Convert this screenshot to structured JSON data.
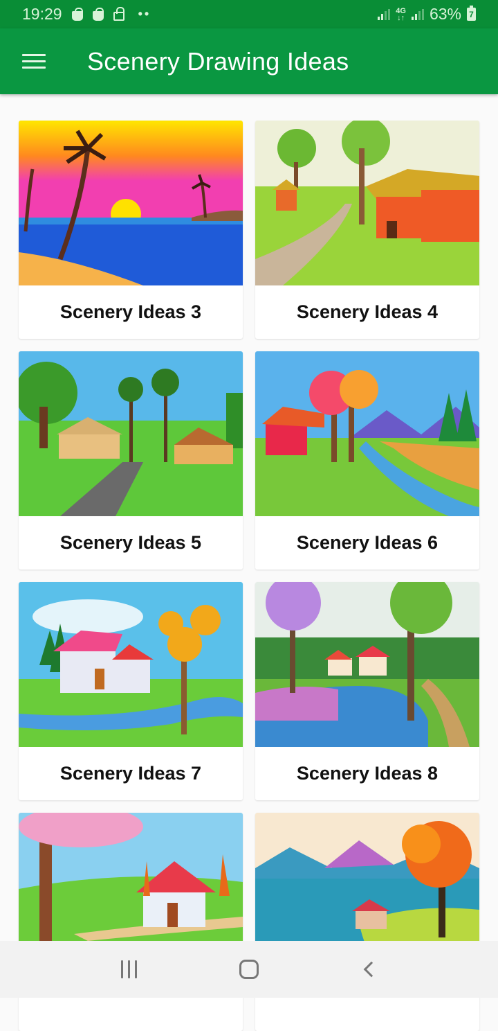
{
  "status_bar": {
    "time": "19:29",
    "network": "4G",
    "battery_percent": "63%",
    "battery_glyph": "7",
    "icons": [
      "shopping-bag-icon",
      "shopping-bag-icon",
      "lock-icon",
      "more-dots-icon",
      "signal-icon",
      "4g-icon",
      "signal-icon",
      "battery-charging-icon"
    ]
  },
  "app_bar": {
    "title": "Scenery Drawing Ideas",
    "menu_icon": "hamburger-menu-icon",
    "color": "#0a9741"
  },
  "cards": [
    {
      "label": "Scenery Ideas 3",
      "scene": "sunset-beach-palms"
    },
    {
      "label": "Scenery Ideas 4",
      "scene": "village-houses-path"
    },
    {
      "label": "Scenery Ideas 5",
      "scene": "countryside-huts-road"
    },
    {
      "label": "Scenery Ideas 6",
      "scene": "red-hut-river-mountains"
    },
    {
      "label": "Scenery Ideas 7",
      "scene": "pink-roof-house-stream"
    },
    {
      "label": "Scenery Ideas 8",
      "scene": "spring-trees-river-houses"
    },
    {
      "label": "",
      "scene": "pink-blossom-house-hills"
    },
    {
      "label": "",
      "scene": "autumn-tree-lake-mountains"
    }
  ],
  "nav_bar": {
    "recents_icon": "recents-icon",
    "home_icon": "home-icon",
    "back_icon": "back-icon"
  }
}
